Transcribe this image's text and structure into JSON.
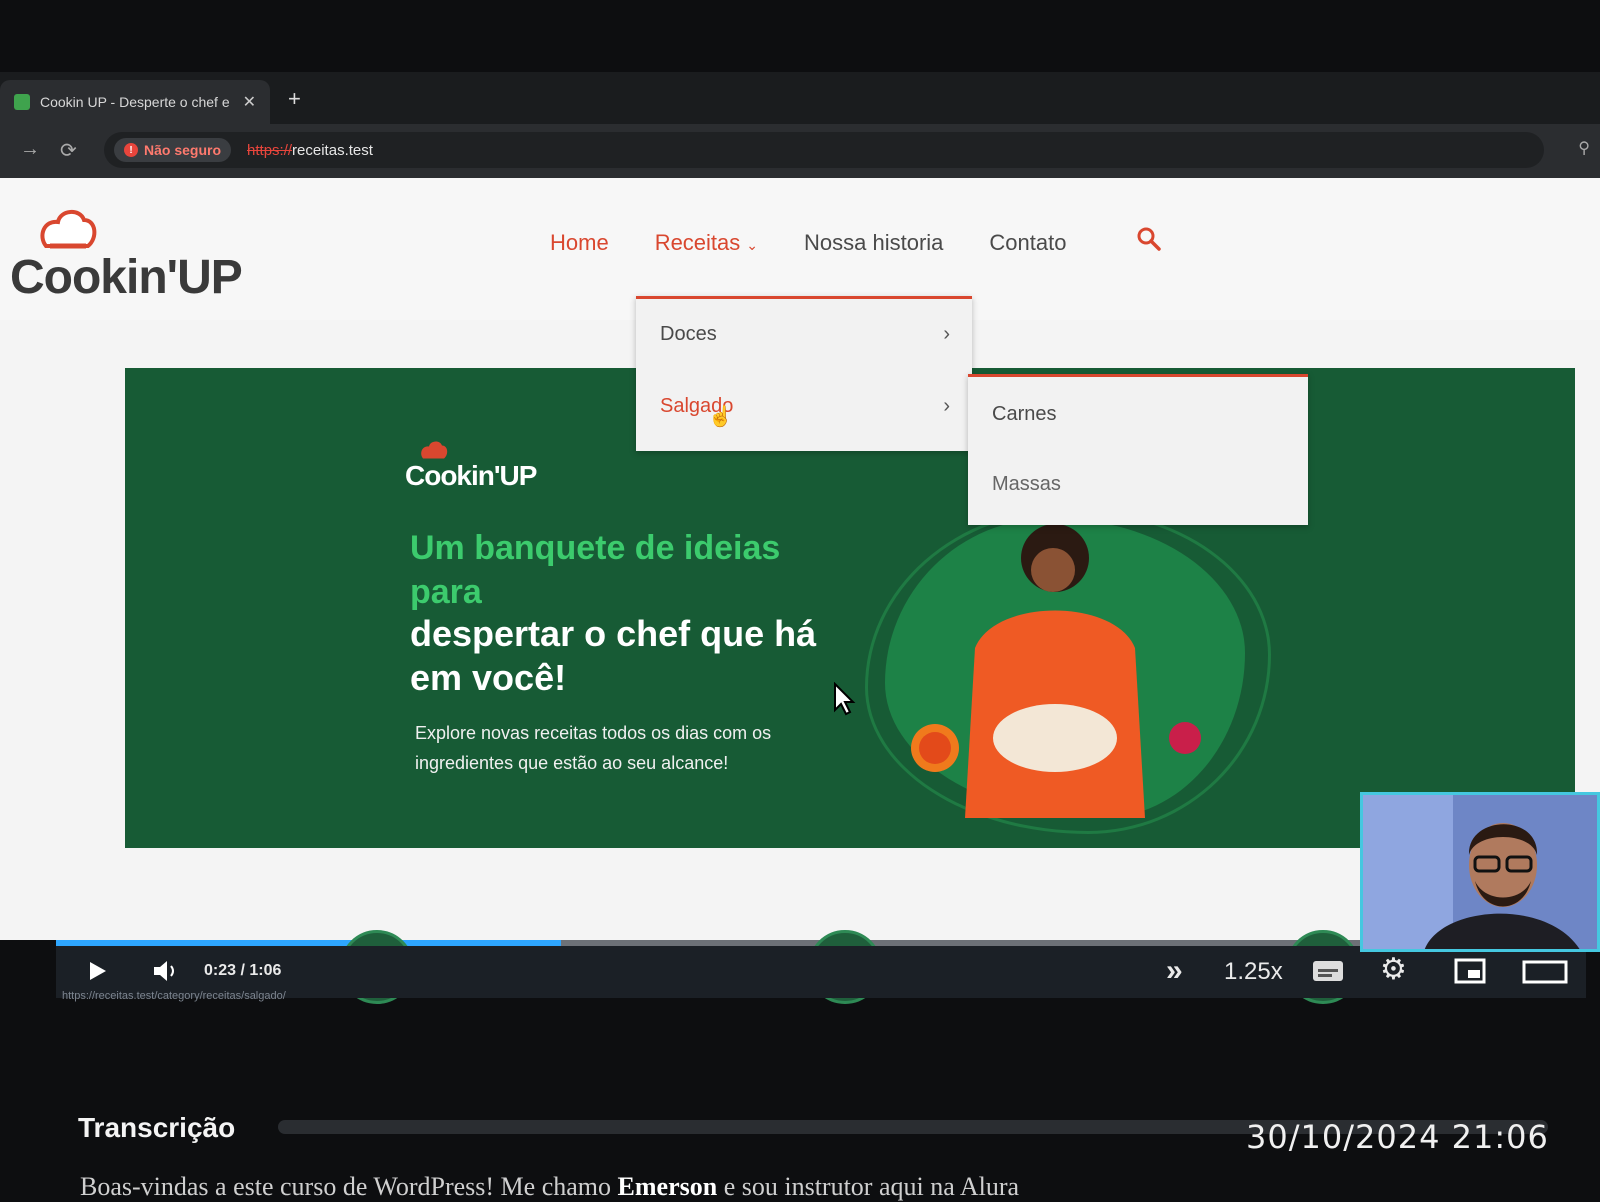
{
  "browser": {
    "tab_title": "Cookin UP - Desperte o chef e",
    "tab_close": "✕",
    "new_tab": "+",
    "security_label": "Não seguro",
    "url_scheme": "https://",
    "url_host": "receitas.test"
  },
  "site": {
    "logo_text": "Cookin'UP",
    "nav": {
      "home": "Home",
      "receitas": "Receitas",
      "nossa_historia": "Nossa historia",
      "contato": "Contato"
    },
    "dropdown": [
      {
        "label": "Doces"
      },
      {
        "label": "Salgado"
      }
    ],
    "submenu": [
      {
        "label": "Carnes"
      },
      {
        "label": "Massas"
      }
    ],
    "hero": {
      "logo_text": "Cookin'UP",
      "headline_green": "Um banquete de ideias para",
      "headline_white": "despertar o chef que há em você!",
      "subtext": "Explore novas receitas todos os dias com os ingredientes que estão ao seu alcance!"
    },
    "colors": {
      "brand_red": "#d9472f",
      "hero_green": "#175b35",
      "accent_green": "#3ccb6d"
    }
  },
  "player": {
    "current_time": "0:23",
    "duration": "1:06",
    "time_separator": "/",
    "speed": "1.25x",
    "status_url": "https://receitas.test/category/receitas/salgado/",
    "progress": 0.33
  },
  "lower": {
    "section_title": "Transcrição",
    "timestamp": "30/10/2024  21:06",
    "transcript_before": "Boas-vindas a este curso de WordPress! Me chamo",
    "transcript_name": "Emerson",
    "transcript_after": "e sou instrutor aqui na Alura"
  }
}
